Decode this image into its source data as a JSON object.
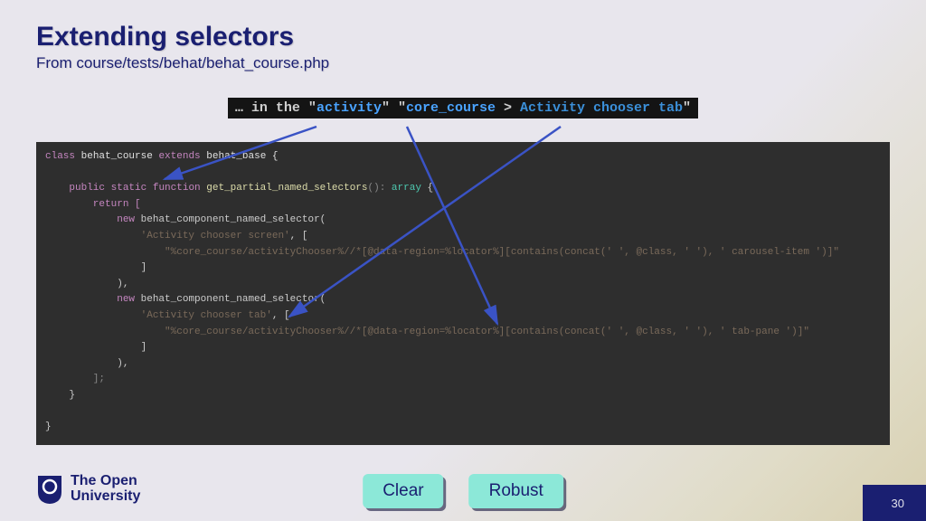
{
  "title": "Extending selectors",
  "subtitle": "From course/tests/behat/behat_course.php",
  "step": {
    "prefix": "… in the \"",
    "activity": "activity",
    "mid1": "\" \"",
    "core": "core_course",
    "mid2": " > ",
    "tab": "Activity chooser tab",
    "suffix": "\""
  },
  "code": {
    "l1_kw1": "class",
    "l1_cls": "behat_course",
    "l1_kw2": "extends",
    "l1_base": "behat_base {",
    "l2_pub": "public",
    "l2_static": "static",
    "l2_func": "function",
    "l2_name": "get_partial_named_selectors",
    "l2_sig": "():",
    "l2_type": "array",
    "l2_brace": " {",
    "l3": "        return [",
    "l4": "            new",
    "l4b": " behat_component_named_selector(",
    "l5": "                'Activity chooser screen'",
    "l5b": ", [",
    "l6": "                    \"%core_course/activityChooser%//*[@data-region=%locator%][contains(concat(' ', @class, ' '), ' carousel-item ')]\"",
    "l7": "                ]",
    "l8": "            ),",
    "l9": "            new",
    "l9b": " behat_component_named_selector(",
    "l10": "                'Activity chooser tab'",
    "l10b": ", [",
    "l11": "                    \"%core_course/activityChooser%//*[@data-region=%locator%][contains(concat(' ', @class, ' '), ' tab-pane ')]\"",
    "l12": "                ]",
    "l13": "            ),",
    "l14": "        ];",
    "l15": "    }",
    "l16": "}"
  },
  "logo": {
    "line1": "The Open",
    "line2": "University"
  },
  "buttons": {
    "clear": "Clear",
    "robust": "Robust"
  },
  "page": "30"
}
